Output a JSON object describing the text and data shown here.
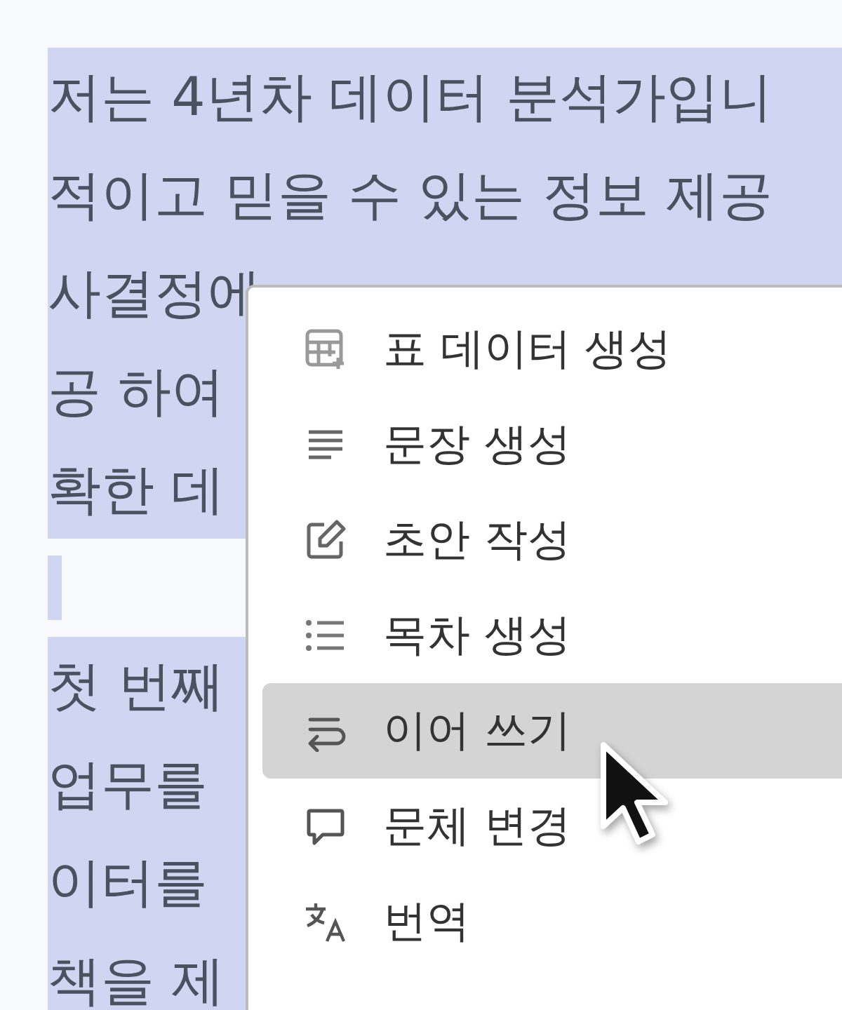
{
  "document": {
    "lines": [
      {
        "text": "저는 4년차 데이터 분석가입니",
        "selected": true
      },
      {
        "text": "적이고 믿을 수 있는 정보 제공",
        "selected": true
      },
      {
        "text": "사결정에",
        "selected": true
      },
      {
        "text": "공 하여",
        "selected": true
      },
      {
        "text": "확한 데",
        "selected": true
      },
      {
        "selected": true
      },
      {
        "text": "첫 번째",
        "selected": true
      },
      {
        "text": "업무를",
        "selected": true
      },
      {
        "text": "이터를",
        "selected": true
      },
      {
        "text": "책을 제",
        "selected": true
      }
    ]
  },
  "context_menu": {
    "items": [
      {
        "label": "표 데이터 생성",
        "selected": false
      },
      {
        "label": "문장 생성",
        "selected": false
      },
      {
        "label": "초안 작성",
        "selected": false
      },
      {
        "label": "목차 생성",
        "selected": false
      },
      {
        "label": "이어 쓰기",
        "selected": true
      },
      {
        "label": "문체 변경",
        "selected": false
      },
      {
        "label": "번역",
        "selected": false
      }
    ]
  }
}
